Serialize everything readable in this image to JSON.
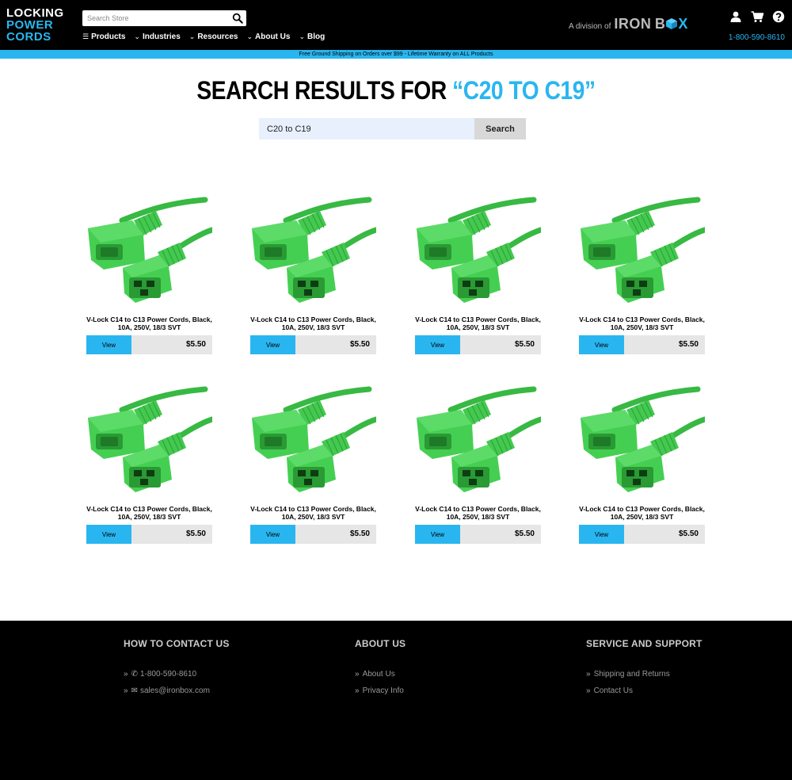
{
  "header": {
    "logo": [
      "LOCKING",
      "POWER",
      "CORDS"
    ],
    "search_placeholder": "Search Store",
    "nav": [
      {
        "label": "Products",
        "icon": "menu-icon"
      },
      {
        "label": "Industries",
        "icon": "chevron-down-icon"
      },
      {
        "label": "Resources",
        "icon": "chevron-down-icon"
      },
      {
        "label": "About Us",
        "icon": "chevron-down-icon"
      },
      {
        "label": "Blog",
        "icon": "chevron-down-icon"
      }
    ],
    "division_prefix": "A division of",
    "division_brand_1": "IRON",
    "division_brand_2": "B",
    "division_brand_3": "X",
    "phone": "1-800-590-8610"
  },
  "banner": "Free Ground Shipping on Orders over $99 - Lifetime Warranty on ALL Products",
  "main": {
    "title_prefix": "SEARCH RESULTS FOR",
    "title_query": "“C20 TO C19”",
    "search_value": "C20 to C19",
    "search_button": "Search",
    "products": [
      {
        "name_1": "V-Lock C14 to C13 Power Cords, Black,",
        "name_2": "10A, 250V, 18/3 SVT",
        "view": "View",
        "price": "$5.50"
      },
      {
        "name_1": "V-Lock C14 to C13 Power Cords, Black,",
        "name_2": "10A, 250V, 18/3 SVT",
        "view": "View",
        "price": "$5.50"
      },
      {
        "name_1": "V-Lock C14 to C13 Power Cords, Black,",
        "name_2": "10A, 250V, 18/3 SVT",
        "view": "View",
        "price": "$5.50"
      },
      {
        "name_1": "V-Lock C14 to C13 Power Cords, Black,",
        "name_2": "10A, 250V, 18/3 SVT",
        "view": "View",
        "price": "$5.50"
      },
      {
        "name_1": "V-Lock C14 to C13 Power Cords, Black,",
        "name_2": "10A, 250V, 18/3 SVT",
        "view": "View",
        "price": "$5.50"
      },
      {
        "name_1": "V-Lock C14 to C13 Power Cords, Black,",
        "name_2": "10A, 250V, 18/3 SVT",
        "view": "View",
        "price": "$5.50"
      },
      {
        "name_1": "V-Lock C14 to C13 Power Cords, Black,",
        "name_2": "10A, 250V, 18/3 SVT",
        "view": "View",
        "price": "$5.50"
      },
      {
        "name_1": "V-Lock C14 to C13 Power Cords, Black,",
        "name_2": "10A, 250V, 18/3 SVT",
        "view": "View",
        "price": "$5.50"
      }
    ]
  },
  "footer": {
    "contact_title": "HOW TO CONTACT US",
    "contact_phone": "1-800-590-8610",
    "contact_email": "sales@ironbox.com",
    "about_title": "ABOUT US",
    "about_links": [
      "About Us",
      "Privacy Info"
    ],
    "service_title": "SERVICE AND SUPPORT",
    "service_links": [
      "Shipping and Returns",
      "Contact Us"
    ]
  },
  "colors": {
    "accent": "#29b6f0",
    "product_green": "#3fc94a",
    "background": "#000000"
  }
}
